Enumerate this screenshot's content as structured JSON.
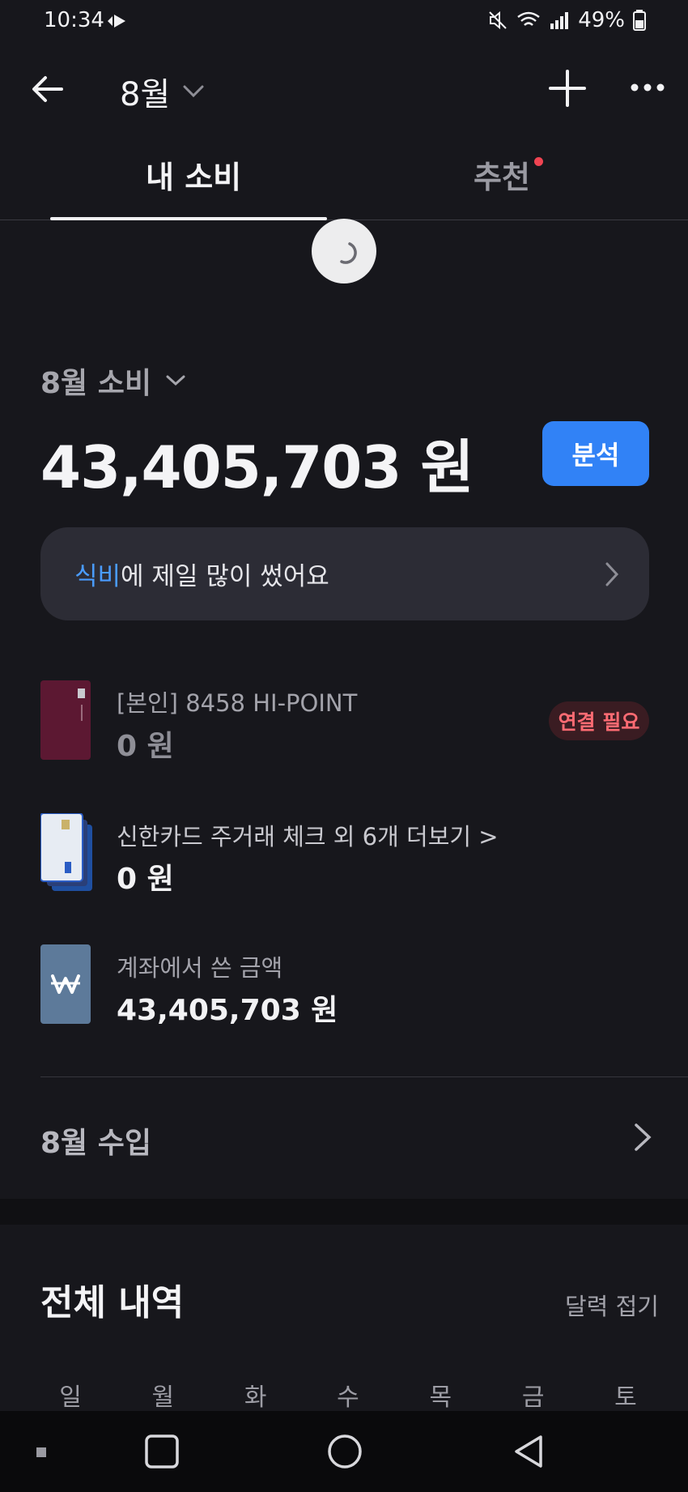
{
  "status_bar": {
    "time": "10:34",
    "battery": "49%"
  },
  "header": {
    "month": "8월"
  },
  "tabs": [
    {
      "label": "내 소비"
    },
    {
      "label": "추천"
    }
  ],
  "summary": {
    "label": "8월 소비",
    "amount": "43,405,703 원",
    "analyze_button": "분석"
  },
  "insight": {
    "highlight": "식비",
    "text": "에 제일 많이 썼어요"
  },
  "accounts": [
    {
      "title": "[본인] 8458 HI-POINT",
      "amount": "0 원",
      "badge": "연결 필요"
    },
    {
      "title": "신한카드 주거래 체크 외 6개 더보기 >",
      "amount": "0 원"
    },
    {
      "title": "계좌에서 쓴 금액",
      "amount": "43,405,703 원"
    }
  ],
  "income": {
    "label": "8월 수입"
  },
  "history": {
    "title": "전체 내역",
    "fold_label": "달력 접기",
    "weekdays": [
      "일",
      "월",
      "화",
      "수",
      "목",
      "금",
      "토"
    ]
  },
  "colors": {
    "accent": "#3182f6",
    "background": "#17171c",
    "badge_text": "#ff6b73"
  }
}
